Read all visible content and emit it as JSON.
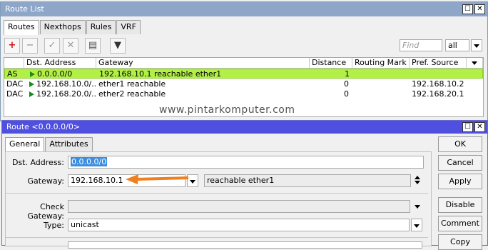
{
  "route_list": {
    "title": "Route List",
    "tabs": [
      "Routes",
      "Nexthops",
      "Rules",
      "VRF"
    ],
    "toolbar": {
      "add": "+",
      "remove": "−",
      "enable": "✓",
      "disable": "✕",
      "comment": "▤",
      "filter": "▼",
      "find_placeholder": "Find",
      "filter_select": "all"
    },
    "columns": [
      "Dst. Address",
      "Gateway",
      "Distance",
      "Routing Mark",
      "Pref. Source"
    ],
    "rows": [
      {
        "flags": "AS",
        "dst": "0.0.0.0/0",
        "gateway": "192.168.10.1 reachable ether1",
        "distance": "1",
        "mark": "",
        "pref": ""
      },
      {
        "flags": "DAC",
        "dst": "192.168.10.0/...",
        "gateway": "ether1 reachable",
        "distance": "0",
        "mark": "",
        "pref": "192.168.10.2"
      },
      {
        "flags": "DAC",
        "dst": "192.168.20.0/...",
        "gateway": "ether2 reachable",
        "distance": "0",
        "mark": "",
        "pref": "192.168.20.1"
      }
    ]
  },
  "watermark": "www.pintarkomputer.com",
  "route_dialog": {
    "title": "Route <0.0.0.0/0>",
    "tabs": [
      "General",
      "Attributes"
    ],
    "dst_address_label": "Dst. Address:",
    "dst_address_value": "0.0.0.0/0",
    "gateway_label": "Gateway:",
    "gateway_value": "192.168.10.1",
    "gateway_status": "reachable ether1",
    "check_gateway_label": "Check Gateway:",
    "check_gateway_value": "",
    "type_label": "Type:",
    "type_value": "unicast",
    "buttons": [
      "OK",
      "Cancel",
      "Apply",
      "Disable",
      "Comment",
      "Copy"
    ]
  },
  "colors": {
    "titlebar": "#8ea7c9",
    "selected_row": "#b3f046",
    "arrow": "#f07f1e",
    "flag_icon": "#1a8a1a"
  }
}
